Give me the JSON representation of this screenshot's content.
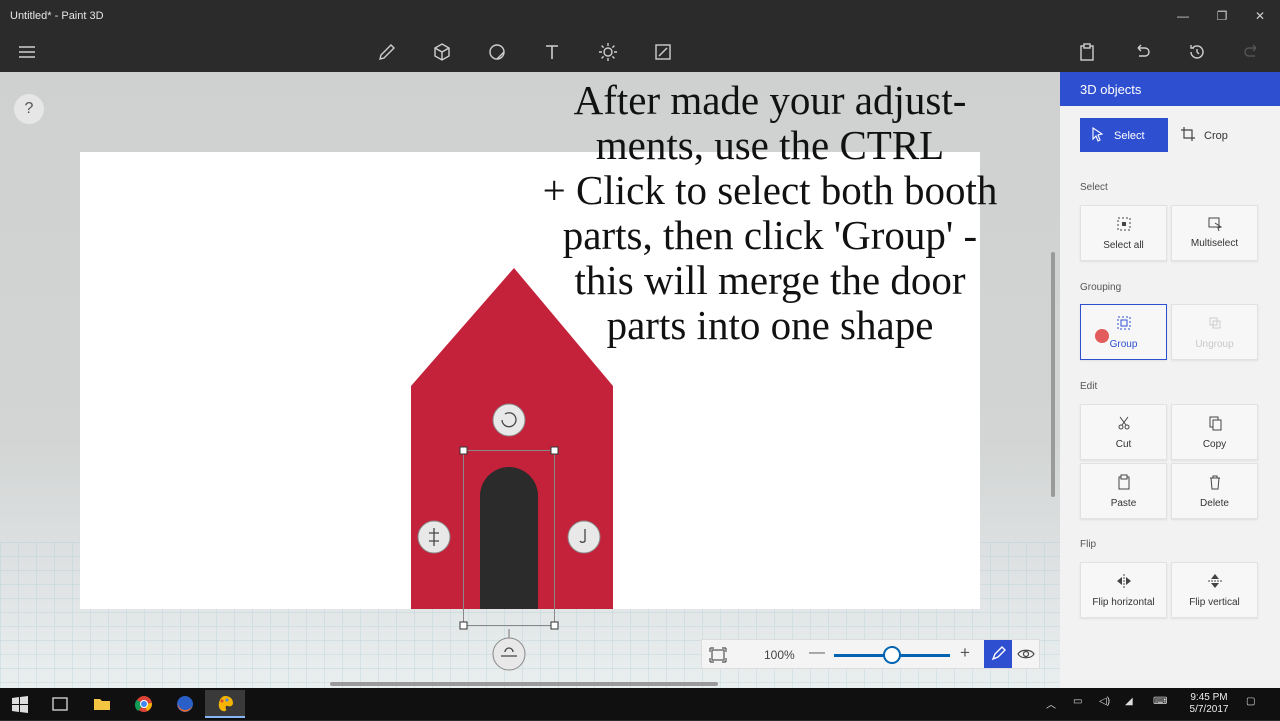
{
  "window": {
    "title": "Untitled* - Paint 3D",
    "minimize_glyph": "—",
    "restore_glyph": "❐",
    "close_glyph": "✕"
  },
  "toolbar": {
    "left_icons": [
      "hamburger-menu-icon"
    ],
    "center_icons": [
      "brushes-icon",
      "3d-shapes-icon",
      "stickers-icon",
      "text-icon",
      "effects-icon",
      "canvas-icon"
    ],
    "right_icons": [
      "paste-icon",
      "undo-icon",
      "history-icon",
      "redo-icon"
    ]
  },
  "help": {
    "label": "?"
  },
  "overlay_text": [
    "After made your adjust-",
    "ments, use the CTRL",
    "+ Click to select both booth",
    "parts, then click 'Group' -",
    "this will merge the door",
    "parts into one shape"
  ],
  "zoom": {
    "value": "100%",
    "level": 0.5,
    "minus": "—",
    "plus": "+"
  },
  "panel": {
    "title": "3D objects",
    "modes": [
      {
        "label": "Select",
        "active": true
      },
      {
        "label": "Crop",
        "active": false
      }
    ],
    "sections": {
      "select": {
        "title": "Select",
        "items": [
          "Select all",
          "Multiselect"
        ]
      },
      "grouping": {
        "title": "Grouping",
        "items": [
          "Group",
          "Ungroup"
        ]
      },
      "edit": {
        "title": "Edit",
        "items": [
          "Cut",
          "Copy",
          "Paste",
          "Delete"
        ]
      },
      "flip": {
        "title": "Flip",
        "items": [
          "Flip horizontal",
          "Flip vertical"
        ]
      }
    }
  },
  "colors": {
    "accent": "#2f4fd1",
    "house": "#c4223a",
    "door": "#2b2b2b",
    "panel_bg": "#f2f2f2"
  },
  "taskbar": {
    "apps": [
      "start-icon",
      "task-view-icon",
      "file-explorer-icon",
      "chrome-icon",
      "firefox-icon",
      "paint-3d-icon"
    ],
    "clock": {
      "time": "9:45 PM",
      "date": "5/7/2017"
    }
  }
}
